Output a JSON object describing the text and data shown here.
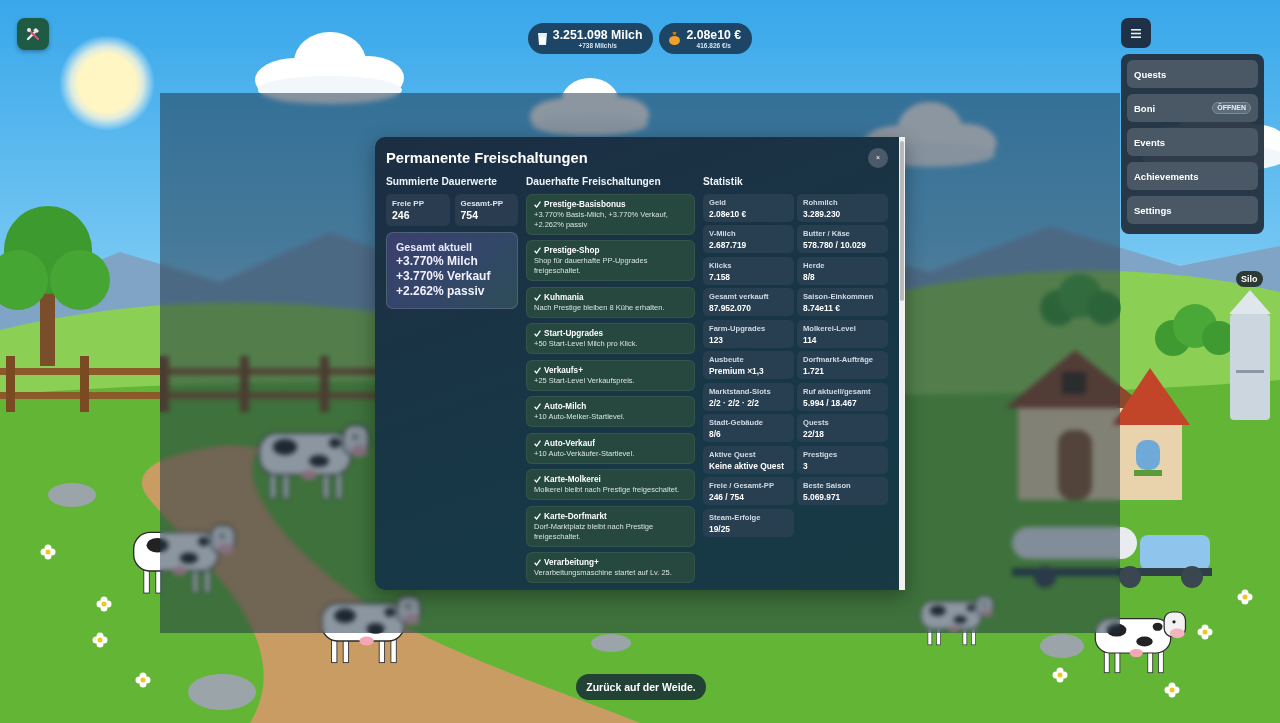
{
  "hud": {
    "resources": [
      {
        "kind": "milk",
        "amount": "3.251.098 Milch",
        "rate": "+738 Milch/s"
      },
      {
        "kind": "money",
        "amount": "2.08e10 €",
        "rate": "416.826 €/s"
      }
    ]
  },
  "menu": {
    "expanded": true,
    "items": [
      {
        "label": "Quests"
      },
      {
        "label": "Boni",
        "badge": "ÖFFNEN"
      },
      {
        "label": "Events"
      },
      {
        "label": "Achievements"
      },
      {
        "label": "Settings"
      }
    ]
  },
  "scene": {
    "silo_label": "Silo"
  },
  "modal": {
    "title": "Permanente Freischaltungen",
    "close_label": "×",
    "summary": {
      "heading": "Summierte Dauerwerte",
      "points": [
        {
          "label": "Freie PP",
          "value": "246"
        },
        {
          "label": "Gesamt-PP",
          "value": "754"
        }
      ],
      "total": {
        "title": "Gesamt aktuell",
        "lines": [
          "+3.770% Milch",
          "+3.770% Verkauf",
          "+2.262% passiv"
        ]
      }
    },
    "unlocks": {
      "heading": "Dauerhafte Freischaltungen",
      "items": [
        {
          "title": "Prestige-Basisbonus",
          "description": "+3.770% Basis-Milch, +3.770% Verkauf, +2.262% passiv",
          "unlocked": true
        },
        {
          "title": "Prestige-Shop",
          "description": "Shop für dauerhafte PP-Upgrades freigeschaltet.",
          "unlocked": true
        },
        {
          "title": "Kuhmania",
          "description": "Nach Prestige bleiben 8 Kühe erhalten.",
          "unlocked": true
        },
        {
          "title": "Start-Upgrades",
          "description": "+50 Start-Level Milch pro Klick.",
          "unlocked": true
        },
        {
          "title": "Verkaufs+",
          "description": "+25 Start-Level Verkaufspreis.",
          "unlocked": true
        },
        {
          "title": "Auto-Milch",
          "description": "+10 Auto-Melker-Startlevel.",
          "unlocked": true
        },
        {
          "title": "Auto-Verkauf",
          "description": "+10 Auto-Verkäufer-Startlevel.",
          "unlocked": true
        },
        {
          "title": "Karte-Molkerei",
          "description": "Molkerei bleibt nach Prestige freigeschaltet.",
          "unlocked": true
        },
        {
          "title": "Karte-Dorfmarkt",
          "description": "Dorf-Marktplatz bleibt nach Prestige freigeschaltet.",
          "unlocked": true
        },
        {
          "title": "Verarbeitung+",
          "description": "Verarbeitungsmaschine startet auf Lv. 25.",
          "unlocked": true
        }
      ]
    },
    "statistics": {
      "heading": "Statistik",
      "items": [
        {
          "label": "Geld",
          "value": "2.08e10 €"
        },
        {
          "label": "Rohmilch",
          "value": "3.289.230"
        },
        {
          "label": "V-Milch",
          "value": "2.687.719"
        },
        {
          "label": "Butter / Käse",
          "value": "578.780 / 10.029"
        },
        {
          "label": "Klicks",
          "value": "7.158"
        },
        {
          "label": "Herde",
          "value": "8/8"
        },
        {
          "label": "Gesamt verkauft",
          "value": "87.952.070"
        },
        {
          "label": "Saison-Einkommen",
          "value": "8.74e11 €"
        },
        {
          "label": "Farm-Upgrades",
          "value": "123"
        },
        {
          "label": "Molkerei-Level",
          "value": "114"
        },
        {
          "label": "Ausbeute",
          "value": "Premium ×1,3"
        },
        {
          "label": "Dorfmarkt-Aufträge",
          "value": "1.721"
        },
        {
          "label": "Marktstand-Slots",
          "value": "2/2 · 2/2 · 2/2"
        },
        {
          "label": "Ruf aktuell/gesamt",
          "value": "5.994 / 18.467"
        },
        {
          "label": "Stadt-Gebäude",
          "value": "8/6"
        },
        {
          "label": "Quests",
          "value": "22/18"
        },
        {
          "label": "Aktive Quest",
          "value": "Keine aktive Quest"
        },
        {
          "label": "Prestiges",
          "value": "3"
        },
        {
          "label": "Freie / Gesamt-PP",
          "value": "246 / 754"
        },
        {
          "label": "Beste Saison",
          "value": "5.069.971"
        },
        {
          "label": "Steam-Erfolge",
          "value": "19/25"
        }
      ]
    }
  },
  "toast": {
    "text": "Zurück auf der Weide."
  }
}
